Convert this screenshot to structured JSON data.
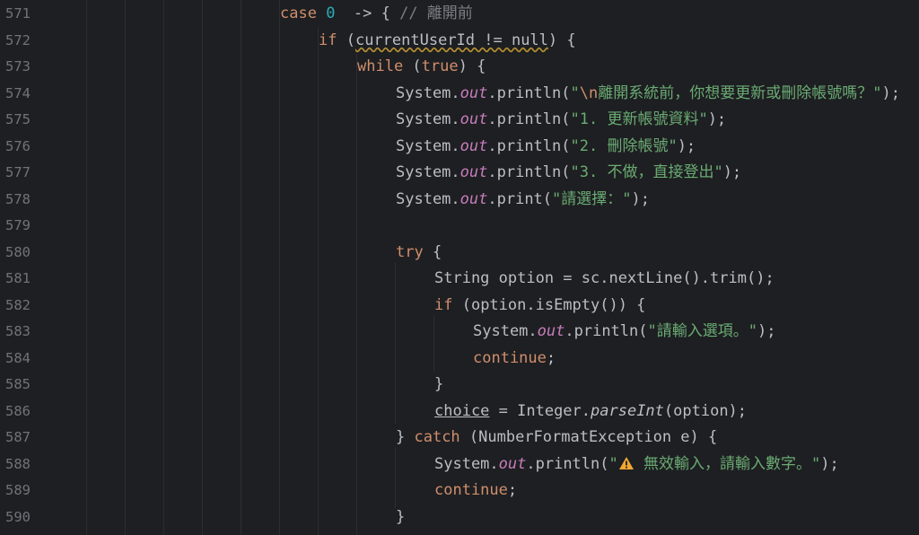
{
  "editor": {
    "lines": [
      {
        "n": "571",
        "indent": "case",
        "tokens": [
          [
            "kw",
            "case "
          ],
          [
            "num",
            "0"
          ],
          [
            "",
            "  -> { "
          ],
          [
            "cmt",
            "// 離開前"
          ]
        ]
      },
      {
        "n": "572",
        "indent": "d2",
        "tokens": [
          [
            "kw",
            "if "
          ],
          [
            "",
            "("
          ],
          [
            "warnul",
            "currentUserId != null"
          ],
          [
            "",
            ") {"
          ]
        ]
      },
      {
        "n": "573",
        "indent": "d3",
        "tokens": [
          [
            "kw",
            "while "
          ],
          [
            "",
            "("
          ],
          [
            "kw",
            "true"
          ],
          [
            "",
            ") {"
          ]
        ]
      },
      {
        "n": "574",
        "indent": "d4",
        "tokens": [
          [
            "",
            "System."
          ],
          [
            "fld",
            "out"
          ],
          [
            "",
            ".println("
          ],
          [
            "str",
            "\""
          ],
          [
            "esc",
            "\\n"
          ],
          [
            "str",
            "離開系統前，你想要更新或刪除帳號嗎？\""
          ],
          [
            "",
            ");"
          ]
        ]
      },
      {
        "n": "575",
        "indent": "d4",
        "tokens": [
          [
            "",
            "System."
          ],
          [
            "fld",
            "out"
          ],
          [
            "",
            ".println("
          ],
          [
            "str",
            "\"1. 更新帳號資料\""
          ],
          [
            "",
            ");"
          ]
        ]
      },
      {
        "n": "576",
        "indent": "d4",
        "tokens": [
          [
            "",
            "System."
          ],
          [
            "fld",
            "out"
          ],
          [
            "",
            ".println("
          ],
          [
            "str",
            "\"2. 刪除帳號\""
          ],
          [
            "",
            ");"
          ]
        ]
      },
      {
        "n": "577",
        "indent": "d4",
        "tokens": [
          [
            "",
            "System."
          ],
          [
            "fld",
            "out"
          ],
          [
            "",
            ".println("
          ],
          [
            "str",
            "\"3. 不做，直接登出\""
          ],
          [
            "",
            ");"
          ]
        ]
      },
      {
        "n": "578",
        "indent": "d4",
        "tokens": [
          [
            "",
            "System."
          ],
          [
            "fld",
            "out"
          ],
          [
            "",
            ".print("
          ],
          [
            "str",
            "\"請選擇：\""
          ],
          [
            "",
            ");"
          ]
        ]
      },
      {
        "n": "579",
        "indent": "d4",
        "tokens": []
      },
      {
        "n": "580",
        "indent": "d4",
        "tokens": [
          [
            "kw",
            "try "
          ],
          [
            "",
            "{"
          ]
        ]
      },
      {
        "n": "581",
        "indent": "d5",
        "tokens": [
          [
            "",
            "String option = sc.nextLine().trim();"
          ]
        ]
      },
      {
        "n": "582",
        "indent": "d5",
        "tokens": [
          [
            "kw",
            "if "
          ],
          [
            "",
            "(option.isEmpty()) {"
          ]
        ]
      },
      {
        "n": "583",
        "indent": "d6",
        "tokens": [
          [
            "",
            "System."
          ],
          [
            "fld",
            "out"
          ],
          [
            "",
            ".println("
          ],
          [
            "str",
            "\"請輸入選項。\""
          ],
          [
            "",
            ");"
          ]
        ]
      },
      {
        "n": "584",
        "indent": "d6",
        "tokens": [
          [
            "kw",
            "continue"
          ],
          [
            "",
            ";"
          ]
        ]
      },
      {
        "n": "585",
        "indent": "d5",
        "tokens": [
          [
            "",
            "}"
          ]
        ]
      },
      {
        "n": "586",
        "indent": "d5",
        "tokens": [
          [
            "ul",
            "choice"
          ],
          [
            "",
            " = Integer."
          ],
          [
            "sfn",
            "parseInt"
          ],
          [
            "",
            "(option);"
          ]
        ]
      },
      {
        "n": "587",
        "indent": "d4",
        "tokens": [
          [
            "",
            "} "
          ],
          [
            "kw",
            "catch "
          ],
          [
            "",
            "(NumberFormatException e) {"
          ]
        ]
      },
      {
        "n": "588",
        "indent": "d5",
        "tokens": [
          [
            "",
            "System."
          ],
          [
            "fld",
            "out"
          ],
          [
            "",
            ".println("
          ],
          [
            "str",
            "\""
          ],
          [
            "icon",
            "warning"
          ],
          [
            "str",
            " 無效輸入，請輸入數字。\""
          ],
          [
            "",
            ");"
          ]
        ]
      },
      {
        "n": "589",
        "indent": "d5",
        "tokens": [
          [
            "kw",
            "continue"
          ],
          [
            "",
            ";"
          ]
        ]
      },
      {
        "n": "590",
        "indent": "d4",
        "tokens": [
          [
            "",
            "}"
          ]
        ]
      }
    ]
  },
  "colors": {
    "background": "#1e1f22",
    "text": "#bcbec4",
    "keyword": "#cf8e6d",
    "number": "#2aacb8",
    "comment": "#7a7e85",
    "string": "#6aab73",
    "field": "#c77dbb",
    "line_number": "#6f737a",
    "warning": "#f0a732"
  }
}
